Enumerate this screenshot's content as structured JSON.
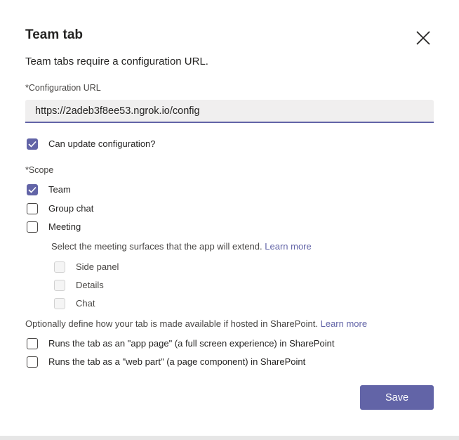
{
  "dialog": {
    "title": "Team tab",
    "subtitle": "Team tabs require a configuration URL.",
    "close_icon": "close-icon"
  },
  "config_url": {
    "label": "*Configuration URL",
    "value": "https://2adeb3f8ee53.ngrok.io/config"
  },
  "can_update": {
    "label": "Can update configuration?",
    "checked": true
  },
  "scope": {
    "label": "*Scope",
    "options": [
      {
        "label": "Team",
        "checked": true
      },
      {
        "label": "Group chat",
        "checked": false
      },
      {
        "label": "Meeting",
        "checked": false
      }
    ]
  },
  "meeting": {
    "info": "Select the meeting surfaces that the app will extend.",
    "learn_more": "Learn more",
    "surfaces": [
      {
        "label": "Side panel",
        "checked": false,
        "disabled": true
      },
      {
        "label": "Details",
        "checked": false,
        "disabled": true
      },
      {
        "label": "Chat",
        "checked": false,
        "disabled": true
      }
    ]
  },
  "sharepoint": {
    "info": "Optionally define how your tab is made available if hosted in SharePoint.",
    "learn_more": "Learn more",
    "options": [
      {
        "label": "Runs the tab as an \"app page\" (a full screen experience) in SharePoint",
        "checked": false
      },
      {
        "label": "Runs the tab as a \"web part\" (a page component) in SharePoint",
        "checked": false
      }
    ]
  },
  "footer": {
    "save_label": "Save"
  },
  "colors": {
    "accent": "#6264a7",
    "input_bg": "#f0efef",
    "text": "#252423"
  }
}
